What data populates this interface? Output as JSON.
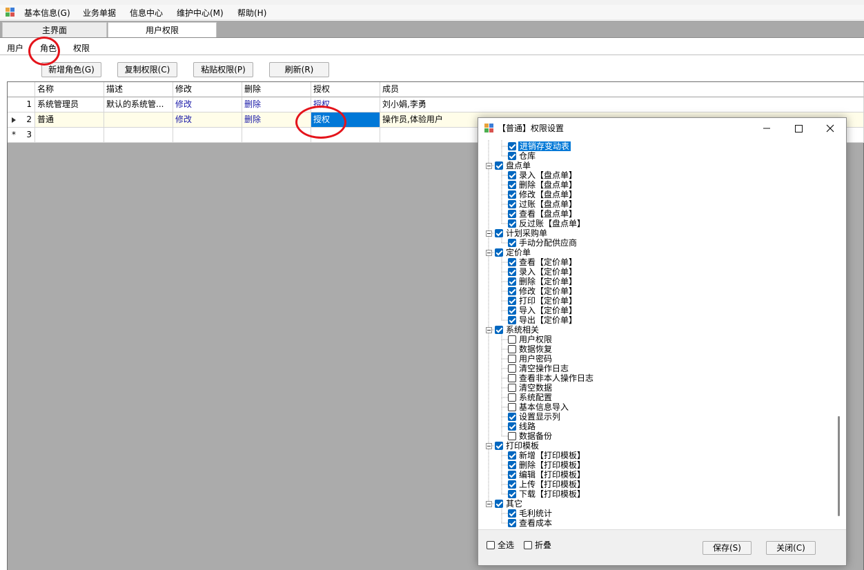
{
  "menu": [
    "基本信息(G)",
    "业务单据",
    "信息中心",
    "维护中心(M)",
    "帮助(H)"
  ],
  "doc_tabs": [
    "主界面",
    "用户权限"
  ],
  "sub_tabs": [
    "用户",
    "角色",
    "权限"
  ],
  "toolbar": [
    "新增角色(G)",
    "复制权限(C)",
    "粘贴权限(P)",
    "刷新(R)"
  ],
  "grid": {
    "columns": [
      "名称",
      "描述",
      "修改",
      "删除",
      "授权",
      "成员"
    ],
    "rows": [
      {
        "num": "1",
        "name": "系统管理员",
        "desc": "默认的系统管...",
        "edit": "修改",
        "delete": "删除",
        "grant": "授权",
        "members": "刘小娟,李勇"
      },
      {
        "num": "2",
        "name": "普通",
        "desc": "",
        "edit": "修改",
        "delete": "删除",
        "grant": "授权",
        "members": "操作员,体验用户"
      },
      {
        "num": "3",
        "name": "",
        "desc": "",
        "edit": "",
        "delete": "",
        "grant": "",
        "members": ""
      }
    ]
  },
  "dialog": {
    "title": "【普通】权限设置",
    "tree": [
      {
        "label": "进销存变动表",
        "level": 1,
        "checked": true,
        "highlight": true
      },
      {
        "label": "仓库",
        "level": 1,
        "checked": true
      },
      {
        "label": "盘点单",
        "level": 0,
        "checked": true
      },
      {
        "label": "录入【盘点单】",
        "level": 1,
        "checked": true
      },
      {
        "label": "删除【盘点单】",
        "level": 1,
        "checked": true
      },
      {
        "label": "修改【盘点单】",
        "level": 1,
        "checked": true
      },
      {
        "label": "过账【盘点单】",
        "level": 1,
        "checked": true
      },
      {
        "label": "查看【盘点单】",
        "level": 1,
        "checked": true
      },
      {
        "label": "反过账【盘点单】",
        "level": 1,
        "checked": true
      },
      {
        "label": "计划采购单",
        "level": 0,
        "checked": true
      },
      {
        "label": "手动分配供应商",
        "level": 1,
        "checked": true
      },
      {
        "label": "定价单",
        "level": 0,
        "checked": true
      },
      {
        "label": "查看【定价单】",
        "level": 1,
        "checked": true
      },
      {
        "label": "录入【定价单】",
        "level": 1,
        "checked": true
      },
      {
        "label": "删除【定价单】",
        "level": 1,
        "checked": true
      },
      {
        "label": "修改【定价单】",
        "level": 1,
        "checked": true
      },
      {
        "label": "打印【定价单】",
        "level": 1,
        "checked": true
      },
      {
        "label": "导入【定价单】",
        "level": 1,
        "checked": true
      },
      {
        "label": "导出【定价单】",
        "level": 1,
        "checked": true
      },
      {
        "label": "系统相关",
        "level": 0,
        "checked": true
      },
      {
        "label": "用户权限",
        "level": 1,
        "checked": false
      },
      {
        "label": "数据恢复",
        "level": 1,
        "checked": false
      },
      {
        "label": "用户密码",
        "level": 1,
        "checked": false
      },
      {
        "label": "清空操作日志",
        "level": 1,
        "checked": false
      },
      {
        "label": "查看非本人操作日志",
        "level": 1,
        "checked": false
      },
      {
        "label": "清空数据",
        "level": 1,
        "checked": false
      },
      {
        "label": "系统配置",
        "level": 1,
        "checked": false
      },
      {
        "label": "基本信息导入",
        "level": 1,
        "checked": false
      },
      {
        "label": "设置显示列",
        "level": 1,
        "checked": true
      },
      {
        "label": "线路",
        "level": 1,
        "checked": true
      },
      {
        "label": "数据备份",
        "level": 1,
        "checked": false
      },
      {
        "label": "打印模板",
        "level": 0,
        "checked": true
      },
      {
        "label": "新增【打印模板】",
        "level": 1,
        "checked": true
      },
      {
        "label": "删除【打印模板】",
        "level": 1,
        "checked": true
      },
      {
        "label": "编辑【打印模板】",
        "level": 1,
        "checked": true
      },
      {
        "label": "上传【打印模板】",
        "level": 1,
        "checked": true
      },
      {
        "label": "下载【打印模板】",
        "level": 1,
        "checked": true
      },
      {
        "label": "其它",
        "level": 0,
        "checked": true
      },
      {
        "label": "毛利统计",
        "level": 1,
        "checked": true
      },
      {
        "label": "查看成本",
        "level": 1,
        "checked": true
      }
    ],
    "select_all": "全选",
    "collapse": "折叠",
    "save": "保存(S)",
    "close": "关闭(C)"
  }
}
